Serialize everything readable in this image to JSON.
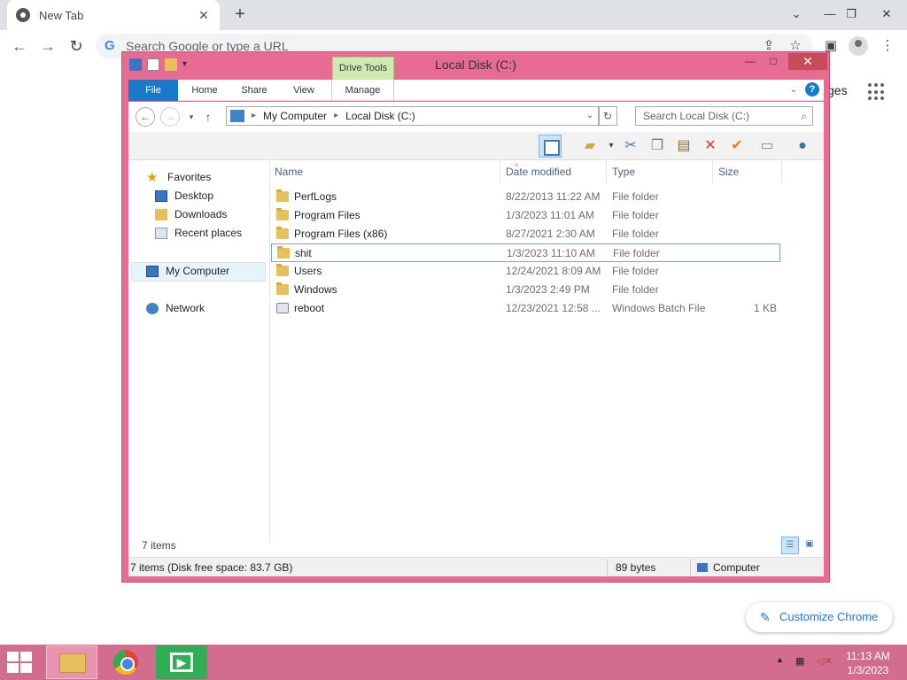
{
  "chrome": {
    "tab_title": "New Tab",
    "tab_close": "✕",
    "new_tab": "+",
    "omnibox_placeholder": "Search Google or type a URL",
    "ntp_partial_text": "ges",
    "customize_label": "Customize Chrome",
    "window_controls": {
      "minimize": "⌄",
      "minimize2": "—",
      "restore": "❐",
      "close": "✕"
    }
  },
  "explorer": {
    "title": "Local Disk (C:)",
    "drive_tools_label": "Drive Tools",
    "ribbon_tabs": [
      "File",
      "Home",
      "Share",
      "View",
      "Manage"
    ],
    "breadcrumb": [
      "My Computer",
      "Local Disk (C:)"
    ],
    "search_placeholder": "Search Local Disk (C:)",
    "columns": [
      "Name",
      "Date modified",
      "Type",
      "Size"
    ],
    "nav": {
      "favorites": "Favorites",
      "desktop": "Desktop",
      "downloads": "Downloads",
      "recent": "Recent places",
      "my_computer": "My Computer",
      "network": "Network"
    },
    "files": [
      {
        "name": "PerfLogs",
        "date": "8/22/2013 11:22 AM",
        "type": "File folder",
        "size": ""
      },
      {
        "name": "Program Files",
        "date": "1/3/2023 11:01 AM",
        "type": "File folder",
        "size": ""
      },
      {
        "name": "Program Files (x86)",
        "date": "8/27/2021 2:30 AM",
        "type": "File folder",
        "size": ""
      },
      {
        "name": "shit",
        "date": "1/3/2023 11:10 AM",
        "type": "File folder",
        "size": ""
      },
      {
        "name": "Users",
        "date": "12/24/2021 8:09 AM",
        "type": "File folder",
        "size": ""
      },
      {
        "name": "Windows",
        "date": "1/3/2023 2:49 PM",
        "type": "File folder",
        "size": ""
      },
      {
        "name": "reboot",
        "date": "12/23/2021 12:58 ...",
        "type": "Windows Batch File",
        "size": "1 KB"
      }
    ],
    "items_count": "7 items",
    "status": {
      "left": "7 items (Disk free space: 83.7 GB)",
      "middle": "89 bytes",
      "right": "Computer"
    }
  },
  "taskbar": {
    "time": "11:13 AM",
    "date": "1/3/2023"
  }
}
